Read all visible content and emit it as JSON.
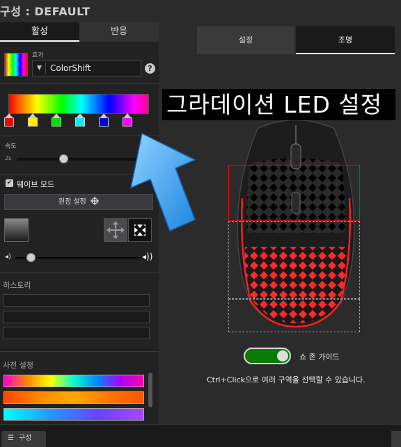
{
  "header": {
    "title": "구성 : DEFAULT"
  },
  "left_tabs": [
    {
      "label": "활성"
    },
    {
      "label": "반응"
    }
  ],
  "effect": {
    "label": "효과",
    "value": "ColorShift",
    "help": "?"
  },
  "gradient_stops": [
    {
      "color": "#ff0000"
    },
    {
      "color": "#ffee00"
    },
    {
      "color": "#00dd00"
    },
    {
      "color": "#00eeee"
    },
    {
      "color": "#0000dd"
    },
    {
      "color": "#ff00ff"
    }
  ],
  "speed": {
    "label": "속도",
    "min_label": "2s",
    "level": 0.34
  },
  "wave_mode": {
    "label": "웨이브 모드",
    "checked": true
  },
  "origin_button": {
    "label": "원점 설정"
  },
  "volume": {
    "level": 0.12
  },
  "history": {
    "label": "히스토리"
  },
  "presets": {
    "label": "사전 설정"
  },
  "right_tabs": [
    {
      "label": "설정"
    },
    {
      "label": "조명"
    }
  ],
  "overlay": {
    "text": "그라데이션 LED 설정"
  },
  "zone_guide": {
    "label": "쇼 존 가이드",
    "on": true
  },
  "hint": {
    "text": "Ctrl+Click으로 여러 구역을 선택할 수 있습니다."
  },
  "bottom": {
    "config_label": "구성"
  },
  "colors": {
    "accent_green": "#0a7a0a",
    "zone_red": "#e01010",
    "arrow_blue": "#39a6f0"
  }
}
